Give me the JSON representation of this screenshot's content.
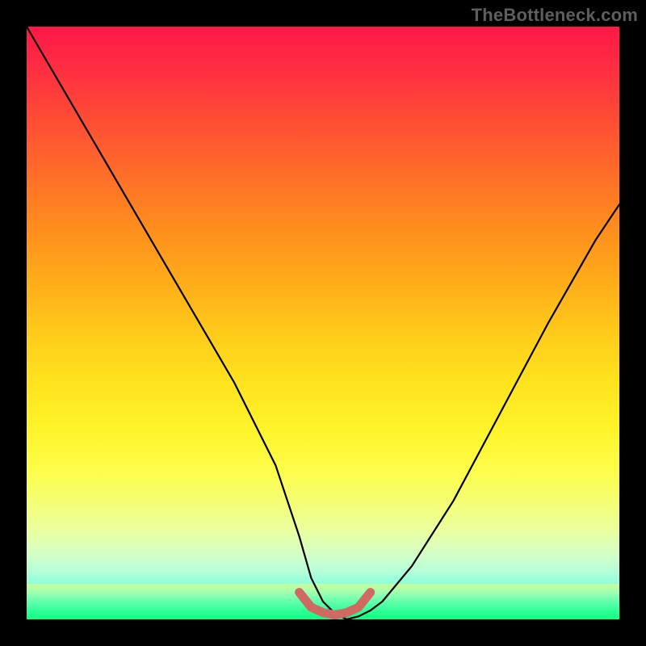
{
  "watermark": "TheBottleneck.com",
  "chart_data": {
    "type": "line",
    "title": "",
    "xlabel": "",
    "ylabel": "",
    "xlim": [
      0,
      100
    ],
    "ylim": [
      0,
      100
    ],
    "series": [
      {
        "name": "bottleneck-curve",
        "x": [
          0,
          7,
          14,
          21,
          28,
          35,
          42,
          46,
          48,
          50,
          52,
          54,
          56,
          58,
          60,
          65,
          72,
          80,
          88,
          96,
          100
        ],
        "y": [
          100,
          88,
          76,
          64,
          52,
          40,
          26,
          14,
          7,
          3,
          1,
          0,
          0.5,
          1.5,
          3,
          9,
          20,
          35,
          50,
          64,
          70
        ]
      }
    ],
    "annotations": [
      {
        "name": "basin-highlight",
        "approx_x_range": [
          46,
          58
        ],
        "approx_y": 0,
        "color": "#cf6a63"
      }
    ],
    "background_gradient": {
      "orientation": "vertical",
      "stops": [
        {
          "pos": 0.0,
          "color": "#ff1846"
        },
        {
          "pos": 0.35,
          "color": "#ff8a1e"
        },
        {
          "pos": 0.65,
          "color": "#ffe31e"
        },
        {
          "pos": 0.9,
          "color": "#d4ffc6"
        },
        {
          "pos": 1.0,
          "color": "#00ff88"
        }
      ]
    }
  }
}
